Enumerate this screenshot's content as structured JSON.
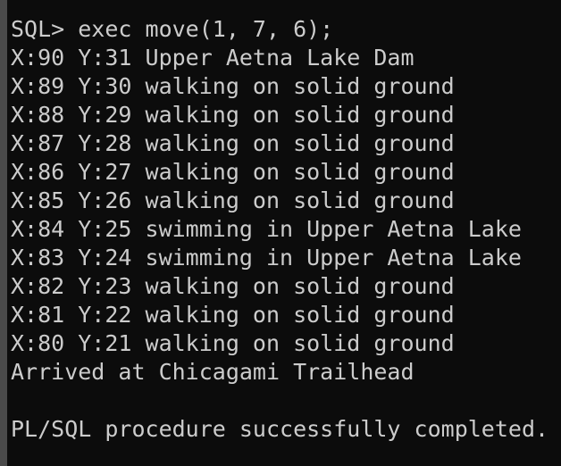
{
  "terminal": {
    "lines": [
      "SQL> exec move(1, 7, 6);",
      "X:90 Y:31 Upper Aetna Lake Dam",
      "X:89 Y:30 walking on solid ground",
      "X:88 Y:29 walking on solid ground",
      "X:87 Y:28 walking on solid ground",
      "X:86 Y:27 walking on solid ground",
      "X:85 Y:26 walking on solid ground",
      "X:84 Y:25 swimming in Upper Aetna Lake",
      "X:83 Y:24 swimming in Upper Aetna Lake",
      "X:82 Y:23 walking on solid ground",
      "X:81 Y:22 walking on solid ground",
      "X:80 Y:21 walking on solid ground",
      "Arrived at Chicagami Trailhead",
      "",
      "PL/SQL procedure successfully completed."
    ]
  },
  "colors": {
    "background": "#0c0c0c",
    "text": "#cccccc"
  }
}
